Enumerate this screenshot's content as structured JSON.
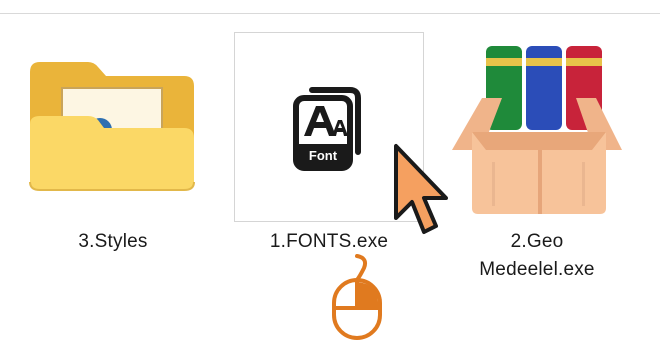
{
  "files": [
    {
      "label": "3.Styles",
      "icon": "folder-icon"
    },
    {
      "label": "1.FONTS.exe",
      "icon": "font-app-icon",
      "icon_text": "Font",
      "selected": true
    },
    {
      "label_line1": "2.Geo",
      "label_line2": "Medeelel.exe",
      "icon": "installer-box-icon"
    }
  ],
  "overlays": {
    "cursor": "arrow-cursor-icon",
    "mouse": "mouse-click-icon"
  },
  "colors": {
    "folder": "#f6c94e",
    "folder_front": "#fbd866",
    "accent_orange": "#e07a1f",
    "cursor_fill": "#f5a060"
  }
}
